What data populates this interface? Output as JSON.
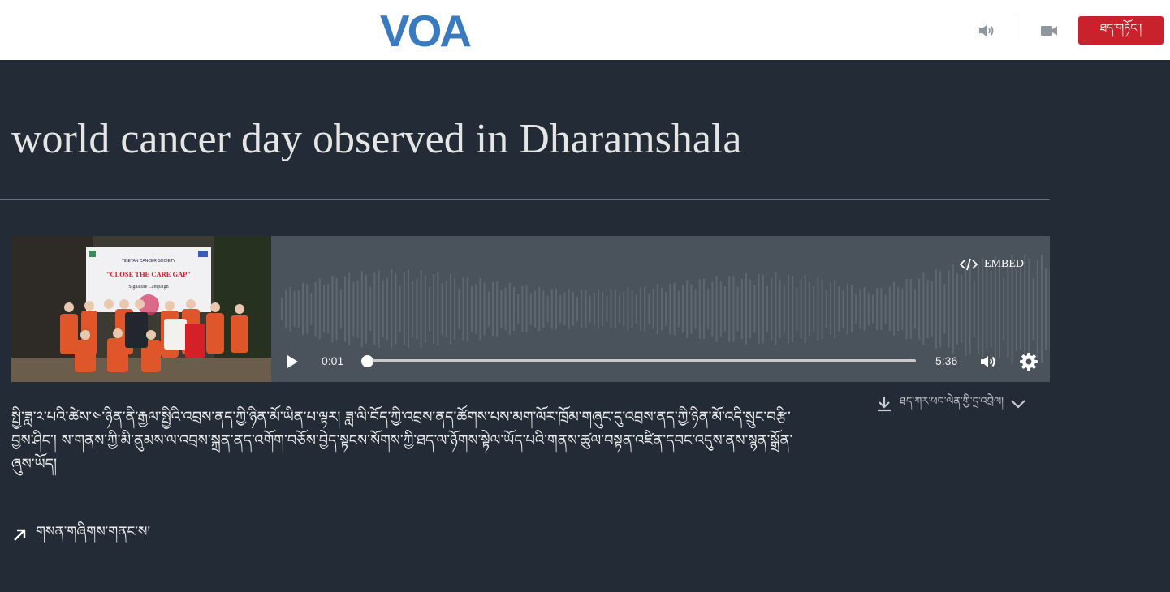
{
  "header": {
    "logo_text": "VOA",
    "live_button_label": "ཐད་གཏོང་།",
    "brand_color": "#3a7bbf",
    "accent_color": "#c8232c",
    "icons": [
      "speaker-icon",
      "video-camera-icon"
    ]
  },
  "article": {
    "title": "world cancer day observed in Dharamshala",
    "description": "སྤྱི་ཟླ་༢་པའི་ཚེས་༤་ཉིན་ནི་རྒྱལ་སྤྱིའི་འབྲས་ནད་ཀྱི་ཉིན་མོ་ཡིན་པ་ལྟར། ཟླ་ལི་བོད་ཀྱི་འབྲས་ནད་ཚོགས་པས་མག་ལོར་ཁྲོམ་གཞུང་དུ་འབྲས་ནད་ཀྱི་ཉིན་མོ་འདི་སྲུང་བརྩི་བྱས་ཤིང་། ས་གནས་ཀྱི་མི་ནུམས་ལ་འབྲས་སྐྲན་ནད་འགོག་བཅོས་བྱེད་སྟངས་སོགས་ཀྱི་ཐད་ལ་ཉོགས་སྟེལ་ཡོད་པའི་གནས་ཚུལ་བསྟན་འཛིན་དབང་འདུས་ནས་སྙན་སྒྲོན་ཞུས་ཡོད།"
  },
  "player": {
    "embed_label": "EMBED",
    "current_time": "0:01",
    "duration": "5:36",
    "progress_fraction": 0.0,
    "thumbnail_banner": {
      "org": "TIBETAN CANCER SOCIETY",
      "slogan": "\"CLOSE THE CARE GAP\"",
      "caption": "Signature Campaign"
    },
    "icons": [
      "play-icon",
      "volume-icon",
      "settings-gear-icon",
      "embed-code-icon"
    ]
  },
  "download": {
    "label": "ཐད་ཀར་ཕབ་ལེན་གྱི་དྲ་འབྲེལ།",
    "icons": [
      "download-icon",
      "chevron-down-icon"
    ]
  },
  "related": {
    "label": "གསན་གཞིགས་གནང་ས།",
    "icon": "arrow-up-right-icon"
  }
}
